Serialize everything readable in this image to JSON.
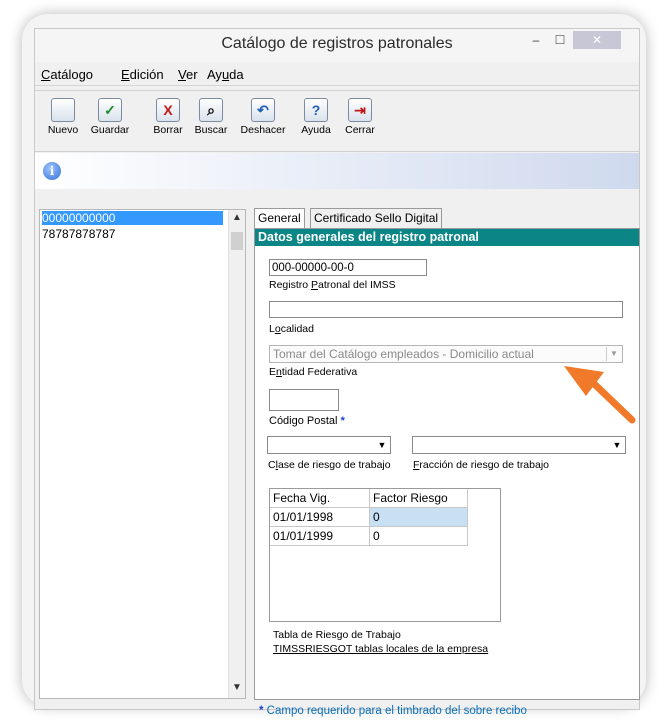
{
  "window": {
    "title": "Catálogo de registros patronales",
    "min": "–",
    "max": "☐",
    "close": "✕"
  },
  "menu": [
    {
      "prefix": "",
      "u": "C",
      "rest": "atálogo"
    },
    {
      "prefix": "",
      "u": "E",
      "rest": "dición"
    },
    {
      "prefix": "",
      "u": "V",
      "rest": "er"
    },
    {
      "prefix": "Ay",
      "u": "u",
      "rest": "da"
    }
  ],
  "toolbar": [
    {
      "label": "Nuevo",
      "icon": "new-doc-icon",
      "glyph": ""
    },
    {
      "label": "Guardar",
      "icon": "check-icon",
      "glyph": "✓"
    },
    {
      "label": "Borrar",
      "icon": "delete-x-icon",
      "glyph": "X"
    },
    {
      "label": "Buscar",
      "icon": "binoculars-icon",
      "glyph": "⌕"
    },
    {
      "label": "Deshacer",
      "icon": "undo-icon",
      "glyph": "↶"
    },
    {
      "label": "Ayuda",
      "icon": "help-icon",
      "glyph": "?"
    },
    {
      "label": "Cerrar",
      "icon": "exit-icon",
      "glyph": "⇥"
    }
  ],
  "info_icon": "i",
  "list": {
    "items": [
      "00000000000",
      "78787878787"
    ],
    "selected": 0,
    "up": "▲",
    "down": "▼"
  },
  "tabs": {
    "general": "General",
    "certificado": "Certificado Sello Digital"
  },
  "form": {
    "section_title": "Datos generales del registro patronal",
    "registro_value": "000-00000-00-0",
    "registro_label_pre": "Registro ",
    "registro_label_u": "P",
    "registro_label_post": "atronal del IMSS",
    "localidad_value": "",
    "localidad_label_pre": "L",
    "localidad_label_u": "o",
    "localidad_label_post": "calidad",
    "entidad_value": "Tomar del Catálogo empleados - Domicilio actual",
    "entidad_label_pre": "E",
    "entidad_label_u": "n",
    "entidad_label_post": "tidad Federativa",
    "cp_value": "",
    "cp_label": "Código Postal",
    "required_mark": "*",
    "clase_label_pre": "C",
    "clase_label_u": "l",
    "clase_label_post": "ase de riesgo de trabajo",
    "fraccion_label_u": "F",
    "fraccion_label_post": "racción de riesgo de trabajo",
    "combo_arrow": "▼"
  },
  "risk_table": {
    "headers": [
      "Fecha Vig.",
      "Factor Riesgo"
    ],
    "rows": [
      [
        "01/01/1998",
        "0"
      ],
      [
        "01/01/1999",
        "0"
      ]
    ],
    "caption": "Tabla de Riesgo de Trabajo",
    "link": "TIMSSRIESGOT tablas locales de la empresa"
  },
  "footnote": {
    "star": "*",
    "text": " Campo requerido para el timbrado del sobre recibo"
  },
  "colors": {
    "section_header": "#0b8585",
    "selection": "#3399ff",
    "annotation_arrow": "#f07a2a"
  }
}
